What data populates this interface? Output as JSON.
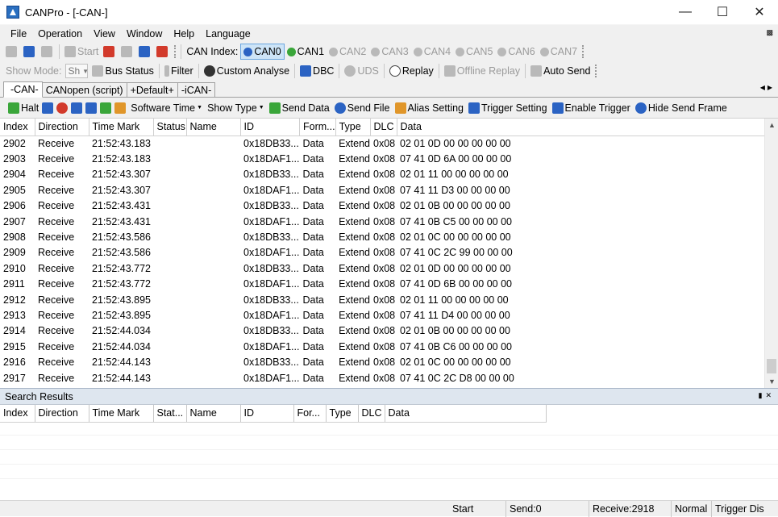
{
  "window": {
    "title": "CANPro - [-CAN-]"
  },
  "menubar": {
    "items": [
      "File",
      "Operation",
      "View",
      "Window",
      "Help",
      "Language"
    ]
  },
  "toolbar1": {
    "start_label": "Start",
    "can_index_label": "CAN Index:",
    "can_channels": [
      "CAN0",
      "CAN1",
      "CAN2",
      "CAN3",
      "CAN4",
      "CAN5",
      "CAN6",
      "CAN7"
    ]
  },
  "toolbar2": {
    "show_mode_label": "Show Mode:",
    "show_mode_value": "Sh",
    "bus_status_label": "Bus Status",
    "filter_label": "Filter",
    "custom_analyse_label": "Custom Analyse",
    "dbc_label": "DBC",
    "uds_label": "UDS",
    "replay_label": "Replay",
    "offline_replay_label": "Offline Replay",
    "auto_send_label": "Auto Send"
  },
  "tabs": [
    "-CAN-",
    "CANopen (script)",
    "+Default+",
    "-iCAN-"
  ],
  "actionbar": {
    "halt_label": "Halt",
    "software_time_label": "Software Time",
    "show_type_label": "Show Type",
    "send_data_label": "Send Data",
    "send_file_label": "Send File",
    "alias_setting_label": "Alias Setting",
    "trigger_setting_label": "Trigger Setting",
    "enable_trigger_label": "Enable Trigger",
    "hide_send_frame_label": "Hide Send Frame"
  },
  "grid": {
    "columns": [
      "Index",
      "Direction",
      "Time Mark",
      "Status",
      "Name",
      "ID",
      "Form...",
      "Type",
      "DLC",
      "Data"
    ],
    "rows": [
      [
        "2902",
        "Receive",
        "21:52:43.183",
        "",
        "",
        "0x18DB33...",
        "Data",
        "Extend",
        "0x08",
        "02 01 0D 00 00 00 00 00"
      ],
      [
        "2903",
        "Receive",
        "21:52:43.183",
        "",
        "",
        "0x18DAF1...",
        "Data",
        "Extend",
        "0x08",
        "07 41 0D 6A 00 00 00 00"
      ],
      [
        "2904",
        "Receive",
        "21:52:43.307",
        "",
        "",
        "0x18DB33...",
        "Data",
        "Extend",
        "0x08",
        "02 01 11 00 00 00 00 00"
      ],
      [
        "2905",
        "Receive",
        "21:52:43.307",
        "",
        "",
        "0x18DAF1...",
        "Data",
        "Extend",
        "0x08",
        "07 41 11 D3 00 00 00 00"
      ],
      [
        "2906",
        "Receive",
        "21:52:43.431",
        "",
        "",
        "0x18DB33...",
        "Data",
        "Extend",
        "0x08",
        "02 01 0B 00 00 00 00 00"
      ],
      [
        "2907",
        "Receive",
        "21:52:43.431",
        "",
        "",
        "0x18DAF1...",
        "Data",
        "Extend",
        "0x08",
        "07 41 0B C5 00 00 00 00"
      ],
      [
        "2908",
        "Receive",
        "21:52:43.586",
        "",
        "",
        "0x18DB33...",
        "Data",
        "Extend",
        "0x08",
        "02 01 0C 00 00 00 00 00"
      ],
      [
        "2909",
        "Receive",
        "21:52:43.586",
        "",
        "",
        "0x18DAF1...",
        "Data",
        "Extend",
        "0x08",
        "07 41 0C 2C 99 00 00 00"
      ],
      [
        "2910",
        "Receive",
        "21:52:43.772",
        "",
        "",
        "0x18DB33...",
        "Data",
        "Extend",
        "0x08",
        "02 01 0D 00 00 00 00 00"
      ],
      [
        "2911",
        "Receive",
        "21:52:43.772",
        "",
        "",
        "0x18DAF1...",
        "Data",
        "Extend",
        "0x08",
        "07 41 0D 6B 00 00 00 00"
      ],
      [
        "2912",
        "Receive",
        "21:52:43.895",
        "",
        "",
        "0x18DB33...",
        "Data",
        "Extend",
        "0x08",
        "02 01 11 00 00 00 00 00"
      ],
      [
        "2913",
        "Receive",
        "21:52:43.895",
        "",
        "",
        "0x18DAF1...",
        "Data",
        "Extend",
        "0x08",
        "07 41 11 D4 00 00 00 00"
      ],
      [
        "2914",
        "Receive",
        "21:52:44.034",
        "",
        "",
        "0x18DB33...",
        "Data",
        "Extend",
        "0x08",
        "02 01 0B 00 00 00 00 00"
      ],
      [
        "2915",
        "Receive",
        "21:52:44.034",
        "",
        "",
        "0x18DAF1...",
        "Data",
        "Extend",
        "0x08",
        "07 41 0B C6 00 00 00 00"
      ],
      [
        "2916",
        "Receive",
        "21:52:44.143",
        "",
        "",
        "0x18DB33...",
        "Data",
        "Extend",
        "0x08",
        "02 01 0C 00 00 00 00 00"
      ],
      [
        "2917",
        "Receive",
        "21:52:44.143",
        "",
        "",
        "0x18DAF1...",
        "Data",
        "Extend",
        "0x08",
        "07 41 0C 2C D8 00 00 00"
      ]
    ]
  },
  "search": {
    "title": "Search Results",
    "columns": [
      "Index",
      "Direction",
      "Time Mark",
      "Stat...",
      "Name",
      "ID",
      "For...",
      "Type",
      "DLC",
      "Data"
    ]
  },
  "statusbar": {
    "start": "Start",
    "send": "Send:0",
    "receive": "Receive:2918",
    "mode": "Normal",
    "trigger": "Trigger Dis"
  }
}
